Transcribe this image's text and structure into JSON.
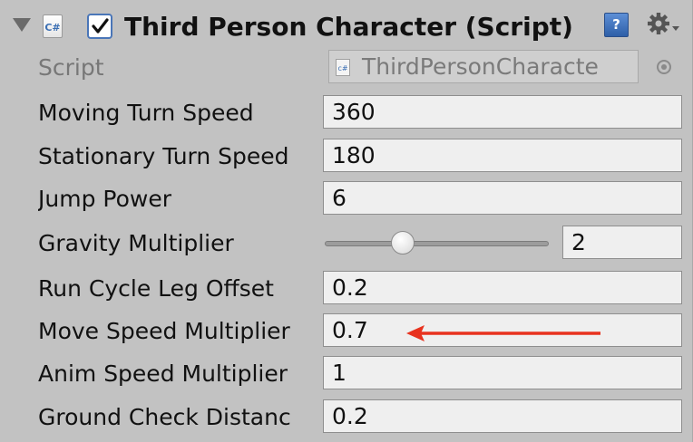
{
  "component": {
    "title": "Third Person Character (Script)",
    "icon": "csharp-script-icon",
    "enabled": true
  },
  "header_icons": {
    "help": "?",
    "help_icon": "help-icon",
    "settings_icon": "gear-icon"
  },
  "fields": {
    "script": {
      "label": "Script",
      "value": "ThirdPersonCharacte"
    },
    "moving_turn_speed": {
      "label": "Moving Turn Speed",
      "value": "360"
    },
    "stationary_turn_speed": {
      "label": "Stationary Turn Speed",
      "value": "180"
    },
    "jump_power": {
      "label": "Jump Power",
      "value": "6"
    },
    "gravity_multiplier": {
      "label": "Gravity Multiplier",
      "value": "2",
      "slider_fraction": 0.33
    },
    "run_cycle_leg_offset": {
      "label": "Run Cycle Leg Offset",
      "value": "0.2"
    },
    "move_speed_multiplier": {
      "label": "Move Speed Multiplier",
      "value": "0.7"
    },
    "anim_speed_multiplier": {
      "label": "Anim Speed Multiplier",
      "value": "1"
    },
    "ground_check_distance": {
      "label": "Ground Check Distanc",
      "value": "0.2"
    }
  },
  "colors": {
    "panel_bg": "#c2c2c2",
    "annotation_arrow": "#e8321e",
    "checkbox_border": "#4a76b8"
  }
}
